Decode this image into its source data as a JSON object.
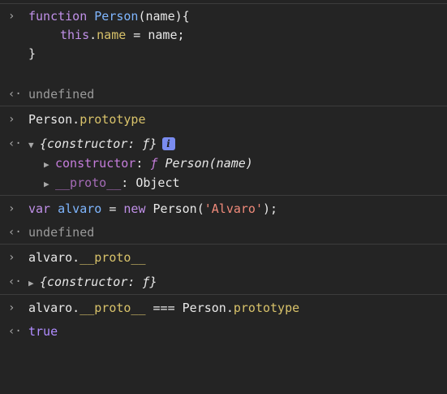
{
  "entries": {
    "e1": {
      "line1": {
        "kw": "function",
        "name": "Person",
        "params": "(name){"
      },
      "line2": {
        "this": "this",
        "dot": ".",
        "prop": "name",
        "rest": " = name;"
      },
      "line3": "}",
      "result": "undefined"
    },
    "e2": {
      "input": {
        "obj": "Person.",
        "prop": "prototype"
      },
      "result_summary": "{constructor: ƒ}",
      "children": [
        {
          "key": "constructor",
          "sep": ": ",
          "f": "ƒ",
          "value": " Person(name)"
        },
        {
          "key": "__proto__",
          "sep": ": ",
          "value": "Object"
        }
      ]
    },
    "e3": {
      "input": {
        "kw1": "var",
        "var": "alvaro",
        "eq": " = ",
        "kw2": "new",
        "cls": " Person(",
        "str": "'Alvaro'",
        "end": ");"
      },
      "result": "undefined"
    },
    "e4": {
      "input": {
        "obj": "alvaro.",
        "prop": "__proto__"
      },
      "result_summary": "{constructor: ƒ}"
    },
    "e5": {
      "input": {
        "obj": "alvaro.",
        "prop": "__proto__",
        "op": " === Person.",
        "prop2": "prototype"
      },
      "result": "true"
    }
  },
  "icons": {
    "input_prompt": "›",
    "output_prompt": "‹·",
    "expanded": "▼",
    "collapsed": "▶",
    "info": "i"
  },
  "colors": {
    "background": "#242424",
    "keyword": "#c090e8",
    "function_name": "#7fb6ff",
    "property": "#d8c26a",
    "string": "#f08a7a",
    "undefined": "#9a9a9a",
    "boolean": "#b08cff"
  }
}
